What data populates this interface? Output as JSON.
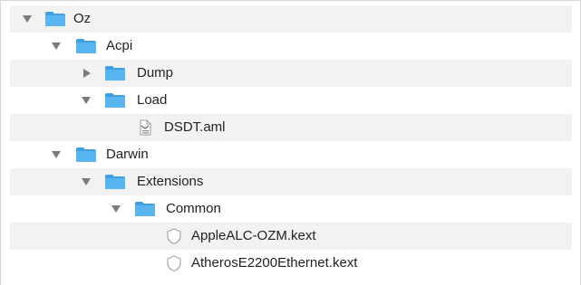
{
  "tree": {
    "oz": {
      "label": "Oz",
      "icon": "folder-icon",
      "expanded": true
    },
    "acpi": {
      "label": "Acpi",
      "icon": "folder-icon",
      "expanded": true
    },
    "dump": {
      "label": "Dump",
      "icon": "folder-icon",
      "expanded": false
    },
    "load": {
      "label": "Load",
      "icon": "folder-icon",
      "expanded": true
    },
    "dsdt": {
      "label": "DSDT.aml",
      "icon": "aml-file-icon"
    },
    "darwin": {
      "label": "Darwin",
      "icon": "folder-icon",
      "expanded": true
    },
    "extensions": {
      "label": "Extensions",
      "icon": "folder-icon",
      "expanded": true
    },
    "common": {
      "label": "Common",
      "icon": "folder-icon",
      "expanded": true
    },
    "applealc": {
      "label": "AppleALC-OZM.kext",
      "icon": "kext-shield-icon"
    },
    "atheros": {
      "label": "AtherosE2200Ethernet.kext",
      "icon": "kext-shield-icon"
    }
  },
  "colors": {
    "folder": "#5ab4ef",
    "folder_tab": "#3f9fe0",
    "alt_row": "#f2f2f2",
    "disclosure": "#7a7a7a"
  }
}
